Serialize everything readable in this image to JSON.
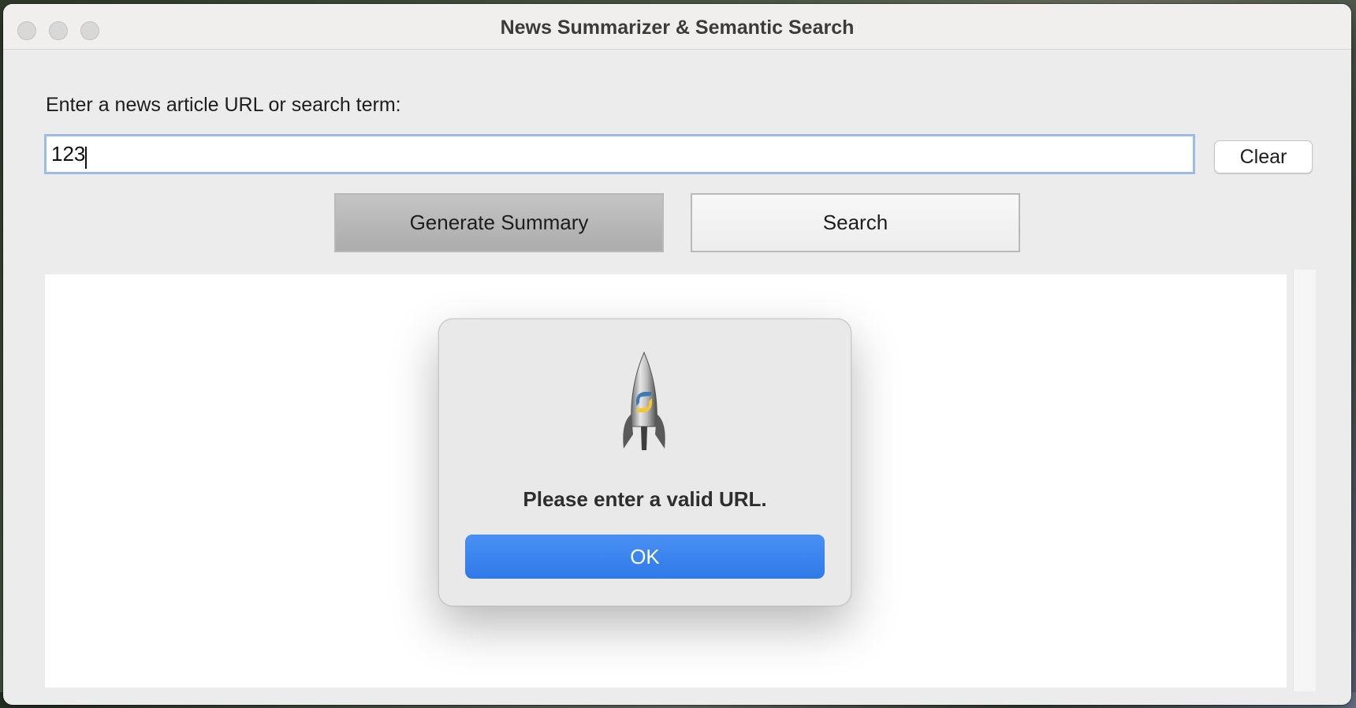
{
  "window": {
    "title": "News Summarizer & Semantic Search"
  },
  "form": {
    "prompt_label": "Enter a news article URL or search term:",
    "input_value": "123",
    "clear_label": "Clear",
    "generate_label": "Generate Summary",
    "search_label": "Search"
  },
  "dialog": {
    "icon": "python-rocket-icon",
    "message": "Please enter a valid URL.",
    "ok_label": "OK"
  },
  "colors": {
    "ok_button": "#3b82f0",
    "input_focus_border": "#9cbbe9",
    "window_bg": "#ececec"
  }
}
